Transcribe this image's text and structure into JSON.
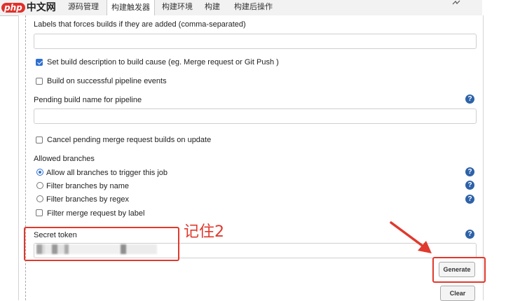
{
  "brand": {
    "php": "php",
    "cn": "中文网"
  },
  "tabs": [
    {
      "label": "源码管理"
    },
    {
      "label": "构建触发器"
    },
    {
      "label": "构建环境"
    },
    {
      "label": "构建"
    },
    {
      "label": "构建后操作"
    }
  ],
  "form": {
    "labels_force_builds": "Labels that forces builds if they are added (comma-separated)",
    "set_build_description": "Set build description to build cause (eg. Merge request or Git Push )",
    "build_on_pipeline": "Build on successful pipeline events",
    "pending_build_name": "Pending build name for pipeline",
    "cancel_pending": "Cancel pending merge request builds on update",
    "allowed_branches": "Allowed branches",
    "branch_options": [
      "Allow all branches to trigger this job",
      "Filter branches by name",
      "Filter branches by regex"
    ],
    "filter_by_label": "Filter merge request by label",
    "secret_token": "Secret token",
    "generate": "Generate",
    "clear": "Clear",
    "help_glyph": "?"
  },
  "annotation": "记住2",
  "colors": {
    "accent_red": "#e0392d",
    "help_blue": "#2d62a8",
    "check_blue": "#2f6fd1"
  }
}
